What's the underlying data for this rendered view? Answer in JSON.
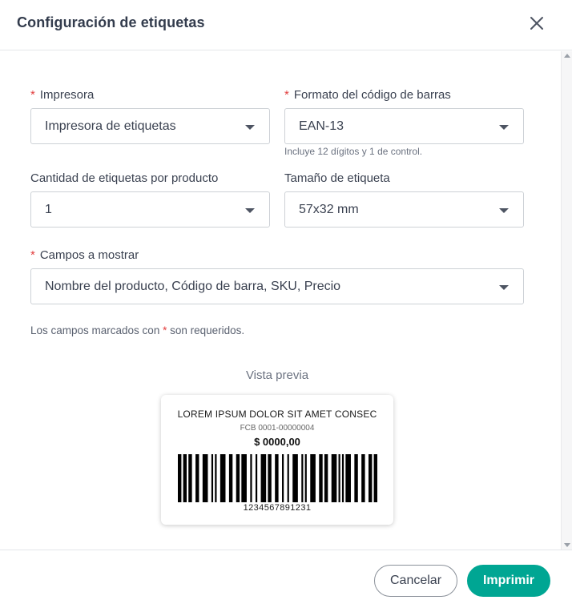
{
  "dialog": {
    "title": "Configuración de etiquetas",
    "close_icon": "close-icon"
  },
  "form": {
    "printer": {
      "label": "Impresora",
      "required_mark": "*",
      "value": "Impresora de etiquetas"
    },
    "barcode_format": {
      "label": "Formato del código de barras",
      "required_mark": "*",
      "value": "EAN-13",
      "hint": "Incluye 12 dígitos y 1 de control."
    },
    "quantity": {
      "label": "Cantidad de etiquetas por producto",
      "value": "1"
    },
    "label_size": {
      "label": "Tamaño de etiqueta",
      "value": "57x32 mm"
    },
    "fields": {
      "label": "Campos a mostrar",
      "required_mark": "*",
      "value": "Nombre del producto, Código de barra, SKU, Precio"
    },
    "required_note_prefix": "Los campos marcados con",
    "required_note_star": "*",
    "required_note_suffix": "son requeridos."
  },
  "preview": {
    "title": "Vista previa",
    "product_name": "LOREM IPSUM DOLOR SIT AMET CONSEC",
    "sku": "FCB 0001-00000004",
    "price": "$ 0000,00",
    "barcode_number": "1234567891231"
  },
  "footer": {
    "cancel_label": "Cancelar",
    "print_label": "Imprimir"
  },
  "colors": {
    "primary": "#00a693",
    "required": "#e23d3d",
    "text": "#3a4150"
  }
}
